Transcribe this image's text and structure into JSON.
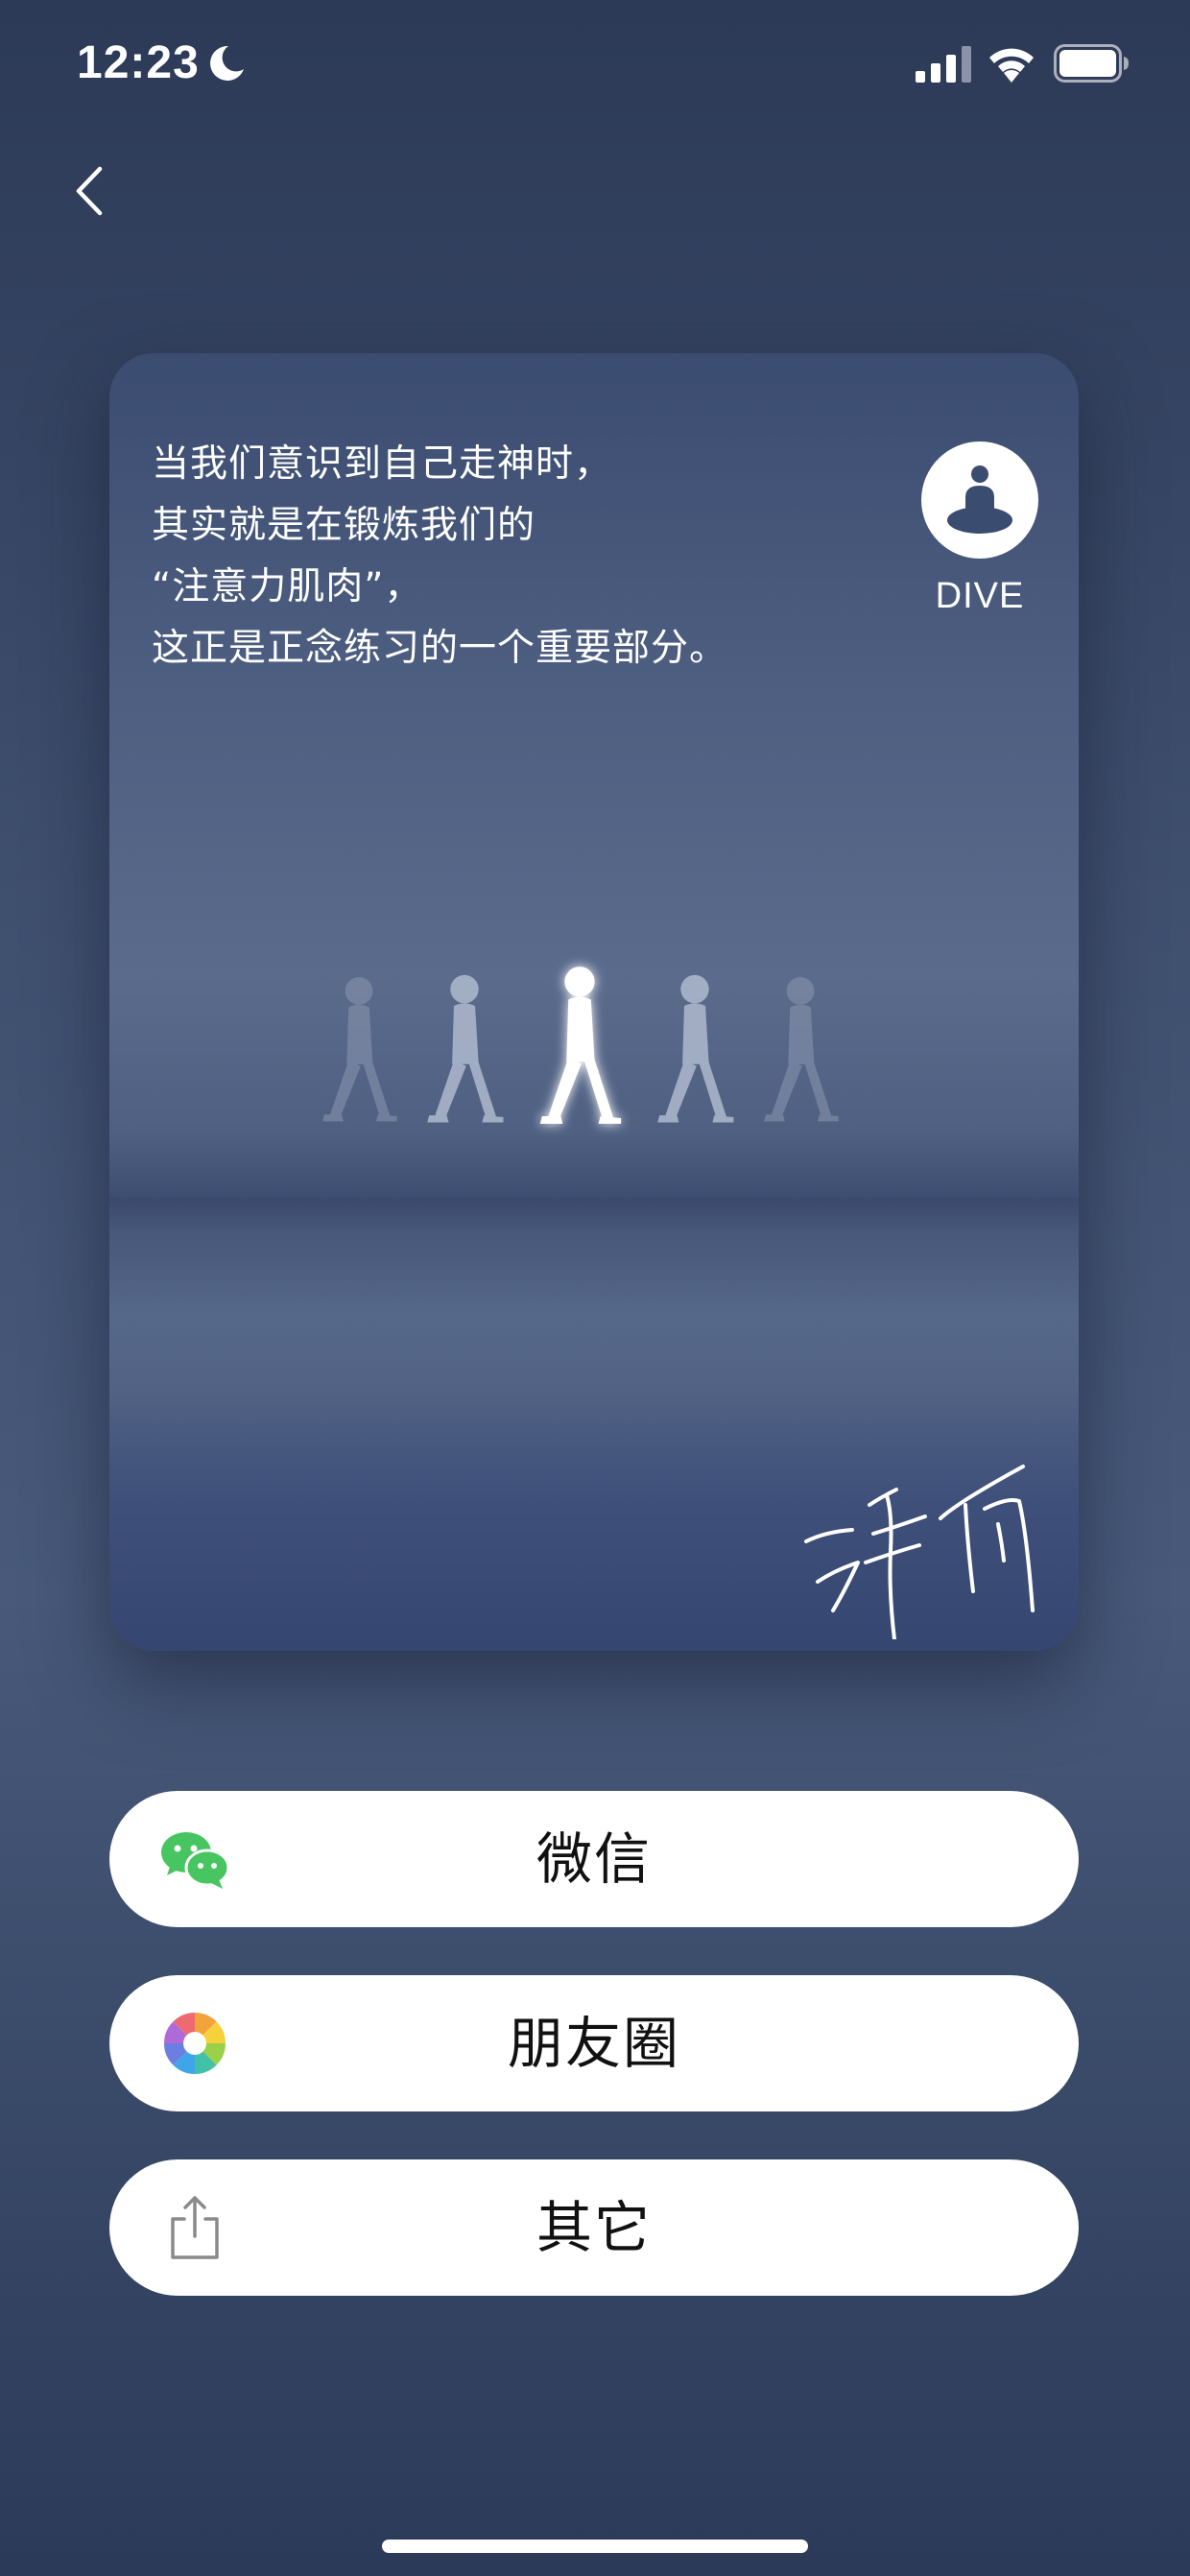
{
  "status_bar": {
    "time": "12:23",
    "icons": [
      "moon-icon",
      "cellular-signal-icon",
      "wifi-icon",
      "battery-icon"
    ]
  },
  "navigation": {
    "back_icon": "chevron-left-icon"
  },
  "card": {
    "quote_lines": [
      "当我们意识到自己走神时，",
      "其实就是在锻炼我们的",
      "“注意力肌肉”，",
      "这正是正念练习的一个重要部分。"
    ],
    "brand_icon": "meditation-figure-icon",
    "brand_name": "DIVE",
    "illustration": "walking-figures-illustration",
    "signature": "handwritten-signature"
  },
  "share_options": [
    {
      "label": "微信",
      "icon": "wechat-icon",
      "accent": "#47c561"
    },
    {
      "label": "朋友圈",
      "icon": "moments-icon",
      "accent": "#f2a33a"
    },
    {
      "label": "其它",
      "icon": "share-icon",
      "accent": "#8a8a8a"
    }
  ],
  "colors": {
    "background": "#2c3a57",
    "card": "#4d5e80",
    "button": "#ffffff",
    "button_text": "#111111"
  }
}
